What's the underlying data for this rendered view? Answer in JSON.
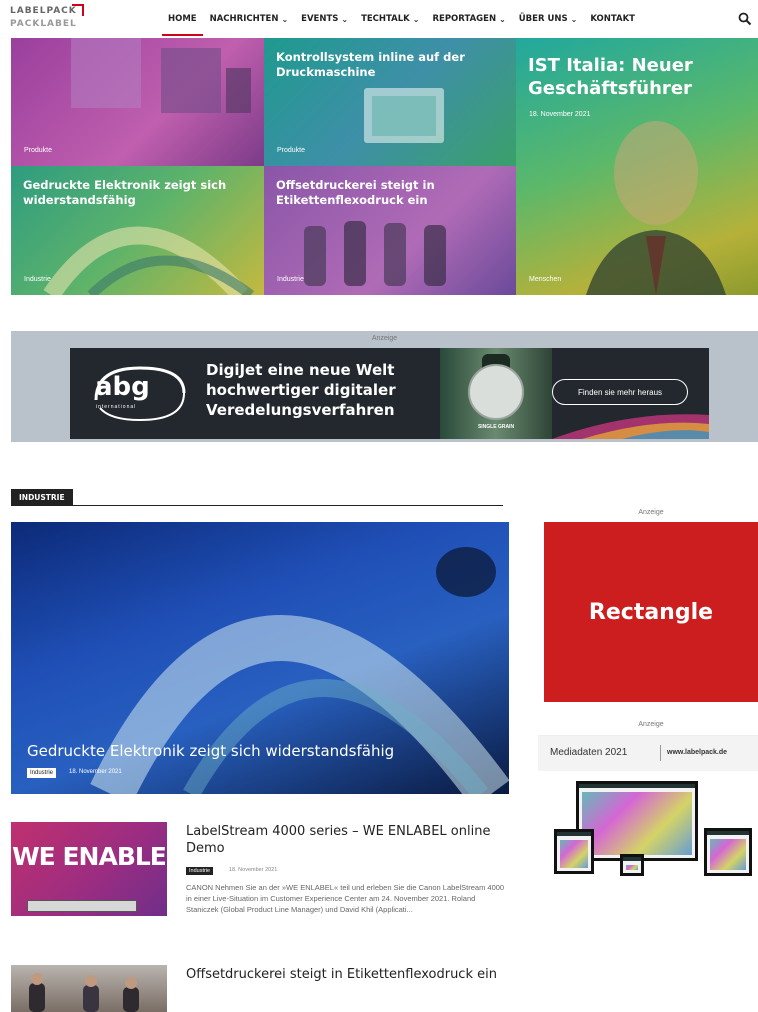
{
  "logo": {
    "line1": "LABELPACK",
    "line2": "PACKLABEL"
  },
  "nav": [
    {
      "label": "HOME",
      "has_menu": false,
      "active": true
    },
    {
      "label": "NACHRICHTEN",
      "has_menu": true
    },
    {
      "label": "EVENTS",
      "has_menu": true
    },
    {
      "label": "TECHTALK",
      "has_menu": true
    },
    {
      "label": "REPORTAGEN",
      "has_menu": true
    },
    {
      "label": "ÜBER UNS",
      "has_menu": true
    },
    {
      "label": "KONTAKT",
      "has_menu": false
    }
  ],
  "chevron": "⌄",
  "hero": {
    "tile_a": {
      "category": "Produkte"
    },
    "tile_b": {
      "title": "Kontrollsystem inline auf der Druckmaschine",
      "category": "Produkte"
    },
    "tile_c": {
      "title": "IST Italia: Neuer Geschäftsführer",
      "date": "18. November 2021",
      "category": "Menschen"
    },
    "tile_d": {
      "title": "Gedruckte Elektronik zeigt sich widerstandsfähig",
      "category": "Industrie"
    },
    "tile_e": {
      "title": "Offsetdruckerei steigt in Etikettenflexodruck ein",
      "category": "Industrie"
    }
  },
  "ad_banner": {
    "label": "Anzeige",
    "logo_text": "abg",
    "logo_sub": "international",
    "headline_1": "DigiJet eine neue Welt",
    "headline_2": "hochwertiger digitaler",
    "headline_3": "Veredelungsverfahren",
    "bottle_label": "SINGLE GRAIN",
    "cta": "Finden sie mehr heraus"
  },
  "section": {
    "title": "INDUSTRIE",
    "feature": {
      "title": "Gedruckte Elektronik zeigt sich widerstandsfähig",
      "category": "Industrie",
      "date": "18. November 2021"
    },
    "articles": [
      {
        "title": "LabelStream 4000 series – WE ENLABEL online Demo",
        "category": "Industrie",
        "date": "18. November 2021",
        "image_text": "WE ENABLE",
        "excerpt": "CANON    Nehmen Sie an der »WE ENLABEL« teil und erleben Sie die Canon LabelStream 4000 in einer Live-Situation im Customer Experience Center am 24. November 2021. Roland Staniczek (Global Product Line Manager) und David Khil (Applicati..."
      },
      {
        "title": "Offsetdruckerei steigt in Etikettenflexodruck ein"
      }
    ]
  },
  "sidebar": {
    "ad1_label": "Anzeige",
    "rect_text": "Rectangle",
    "ad2_label": "Anzeige",
    "media_title": "Mediadaten  2021",
    "media_url": "www.labelpack.de"
  },
  "colors": {
    "accent": "#d0021b",
    "rectangle": "#cc1e1e",
    "dark": "#222222"
  }
}
